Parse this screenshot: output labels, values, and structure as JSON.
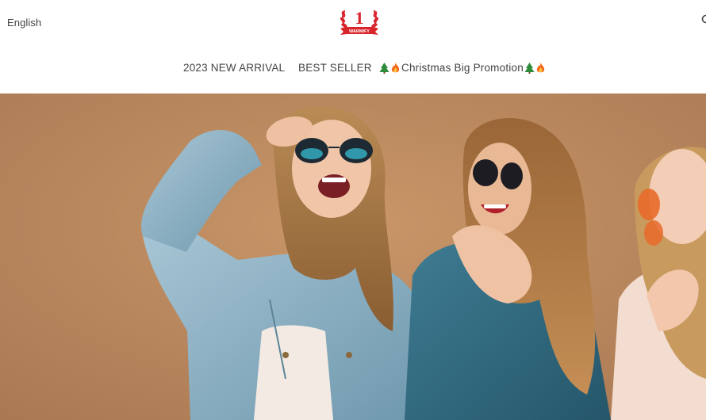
{
  "header": {
    "language_label": "English",
    "logo": {
      "badge_number": "1",
      "banner_text": "WARMIFY",
      "colors": {
        "primary": "#d8242b",
        "accent": "#ffffff"
      }
    },
    "search_icon": "search-icon"
  },
  "nav": {
    "items": [
      {
        "label": "2023 NEW ARRIVAL"
      },
      {
        "label": "BEST SELLER"
      },
      {
        "label": "Christmas Big Promotion",
        "icons": [
          "christmas-tree-icon",
          "fire-icon"
        ]
      }
    ]
  },
  "hero": {
    "description_icon": "hero-banner-image",
    "colors": {
      "background": "#b98a62",
      "denim": "#8fb4c8",
      "dark_denim": "#3b6a7d"
    }
  }
}
